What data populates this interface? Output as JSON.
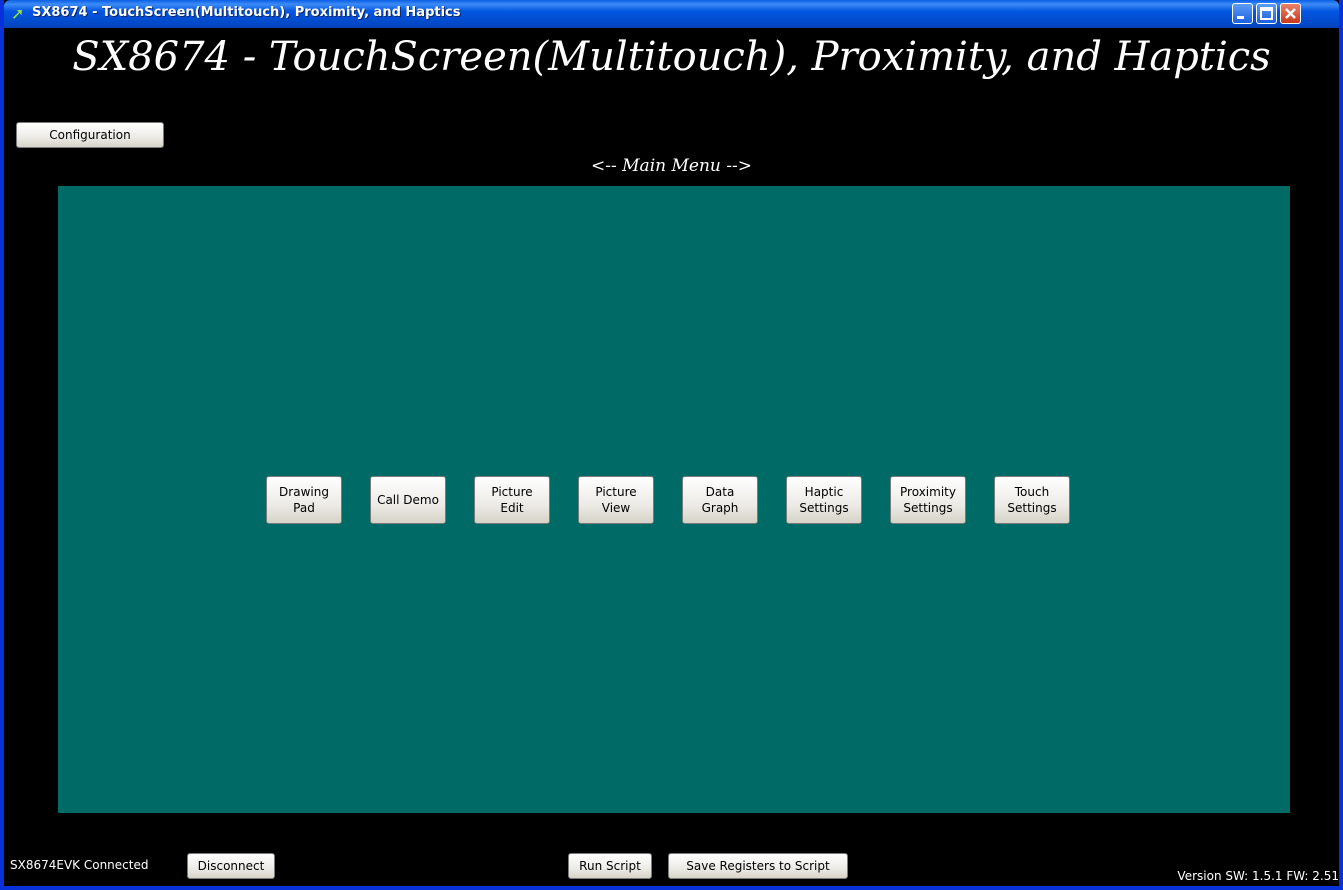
{
  "window": {
    "title": "SX8674 - TouchScreen(Multitouch), Proximity, and Haptics",
    "app_icon": "green-arrow-icon"
  },
  "header": {
    "title": "SX8674 - TouchScreen(Multitouch), Proximity, and Haptics",
    "configuration_label": "Configuration",
    "menu_label": "<-- Main Menu -->"
  },
  "menu": {
    "buttons": [
      {
        "label": "Drawing\nPad"
      },
      {
        "label": "Call Demo"
      },
      {
        "label": "Picture\nEdit"
      },
      {
        "label": "Picture\nView"
      },
      {
        "label": "Data\nGraph"
      },
      {
        "label": "Haptic\nSettings"
      },
      {
        "label": "Proximity\nSettings"
      },
      {
        "label": "Touch\nSettings"
      }
    ]
  },
  "footer": {
    "status": "SX8674EVK Connected",
    "disconnect_label": "Disconnect",
    "run_script_label": "Run Script",
    "save_registers_label": "Save Registers to Script",
    "version": "Version SW: 1.5.1 FW: 2.51"
  },
  "colors": {
    "panel": "#006a66",
    "background": "#000000",
    "titlebar": "#0256e0"
  }
}
